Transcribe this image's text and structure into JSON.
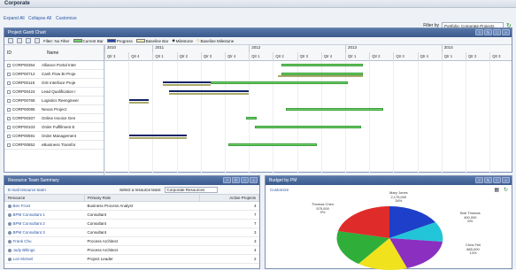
{
  "app": {
    "title": "Corporate"
  },
  "links": {
    "expand_all": "Expand All",
    "collapse_all": "Collapse All",
    "customize": "Customize"
  },
  "filter": {
    "label": "Filter by",
    "value": "Portfolio: Corporate Projects"
  },
  "gantt": {
    "title": "Project Gantt Chart",
    "toolbar": {
      "filter_label": "Filter: No Filter",
      "legend": [
        "Current Bar",
        "Progress",
        "Baseline Bar",
        "Milestone",
        "Baseline Milestone"
      ]
    },
    "headers": {
      "id": "ID",
      "name": "Name"
    },
    "years": [
      "2010",
      "2011",
      "2012",
      "2013",
      "2014"
    ],
    "quarters": [
      "Qtr 3",
      "Qtr 4",
      "Qtr 1",
      "Qtr 2",
      "Qtr 3",
      "Qtr 4",
      "Qtr 1",
      "Qtr 2",
      "Qtr 3",
      "Qtr 4",
      "Qtr 1",
      "Qtr 2",
      "Qtr 3",
      "Qtr 4",
      "Qtr 1",
      "Qtr 2",
      "Qtr 3"
    ],
    "rows": [
      {
        "id": "CORP00364",
        "name": "Alliance Portal Inter"
      },
      {
        "id": "CORP00712",
        "name": "Cash Flow BI Proje"
      },
      {
        "id": "CORP00118",
        "name": "GIS Interface Proje"
      },
      {
        "id": "CORP00424",
        "name": "Lead Qualification I"
      },
      {
        "id": "CORP00768",
        "name": "Logistics Reengineer"
      },
      {
        "id": "CORP00095",
        "name": "Nexus Project"
      },
      {
        "id": "CORP00307",
        "name": "Online Invoice Gen"
      },
      {
        "id": "CORP00103",
        "name": "Order Fulfillment E"
      },
      {
        "id": "CORP00591",
        "name": "Order Management"
      },
      {
        "id": "CORP00852",
        "name": "eBusiness Transfor"
      }
    ]
  },
  "resource_team": {
    "title": "Resource Team Summary",
    "email_link": "E-mail resource team",
    "select_label": "Select a resource team:",
    "select_value": "Corporate Resources",
    "columns": [
      "Resource",
      "Primary Role",
      "Active Projects"
    ],
    "rows": [
      {
        "resource": "Ben Frost",
        "role": "Business Process Analyst",
        "active": "4"
      },
      {
        "resource": "BPM Consultant 1",
        "role": "Consultant",
        "active": "7"
      },
      {
        "resource": "BPM Consultant 2",
        "role": "Consultant",
        "active": "7"
      },
      {
        "resource": "BPM Consultant 3",
        "role": "Consultant",
        "active": "3"
      },
      {
        "resource": "Frank Chu",
        "role": "Process Architect",
        "active": "3"
      },
      {
        "resource": "Judy Billings",
        "role": "Process Architect",
        "active": "4"
      },
      {
        "resource": "Lori McNeil",
        "role": "Project Leader",
        "active": "2"
      }
    ]
  },
  "budget": {
    "title": "Budget by PM",
    "customize": "Customize",
    "colors": {
      "blue": "#1d3fc9",
      "red": "#e02b2b",
      "green": "#2fae3a",
      "yellow": "#f0e21c",
      "purple": "#8a2fbf",
      "cyan": "#22c5d8"
    },
    "labels": [
      {
        "name": "Mary Jones",
        "amount": "2,175,000",
        "pct": "34%"
      },
      {
        "name": "Thomas Chen",
        "amount": "575,000",
        "pct": "9%"
      },
      {
        "name": "Bob Thomas",
        "amount": "400,000",
        "pct": "6%"
      },
      {
        "name": "Chris Fell",
        "amount": "885,000",
        "pct": "14%"
      }
    ]
  }
}
